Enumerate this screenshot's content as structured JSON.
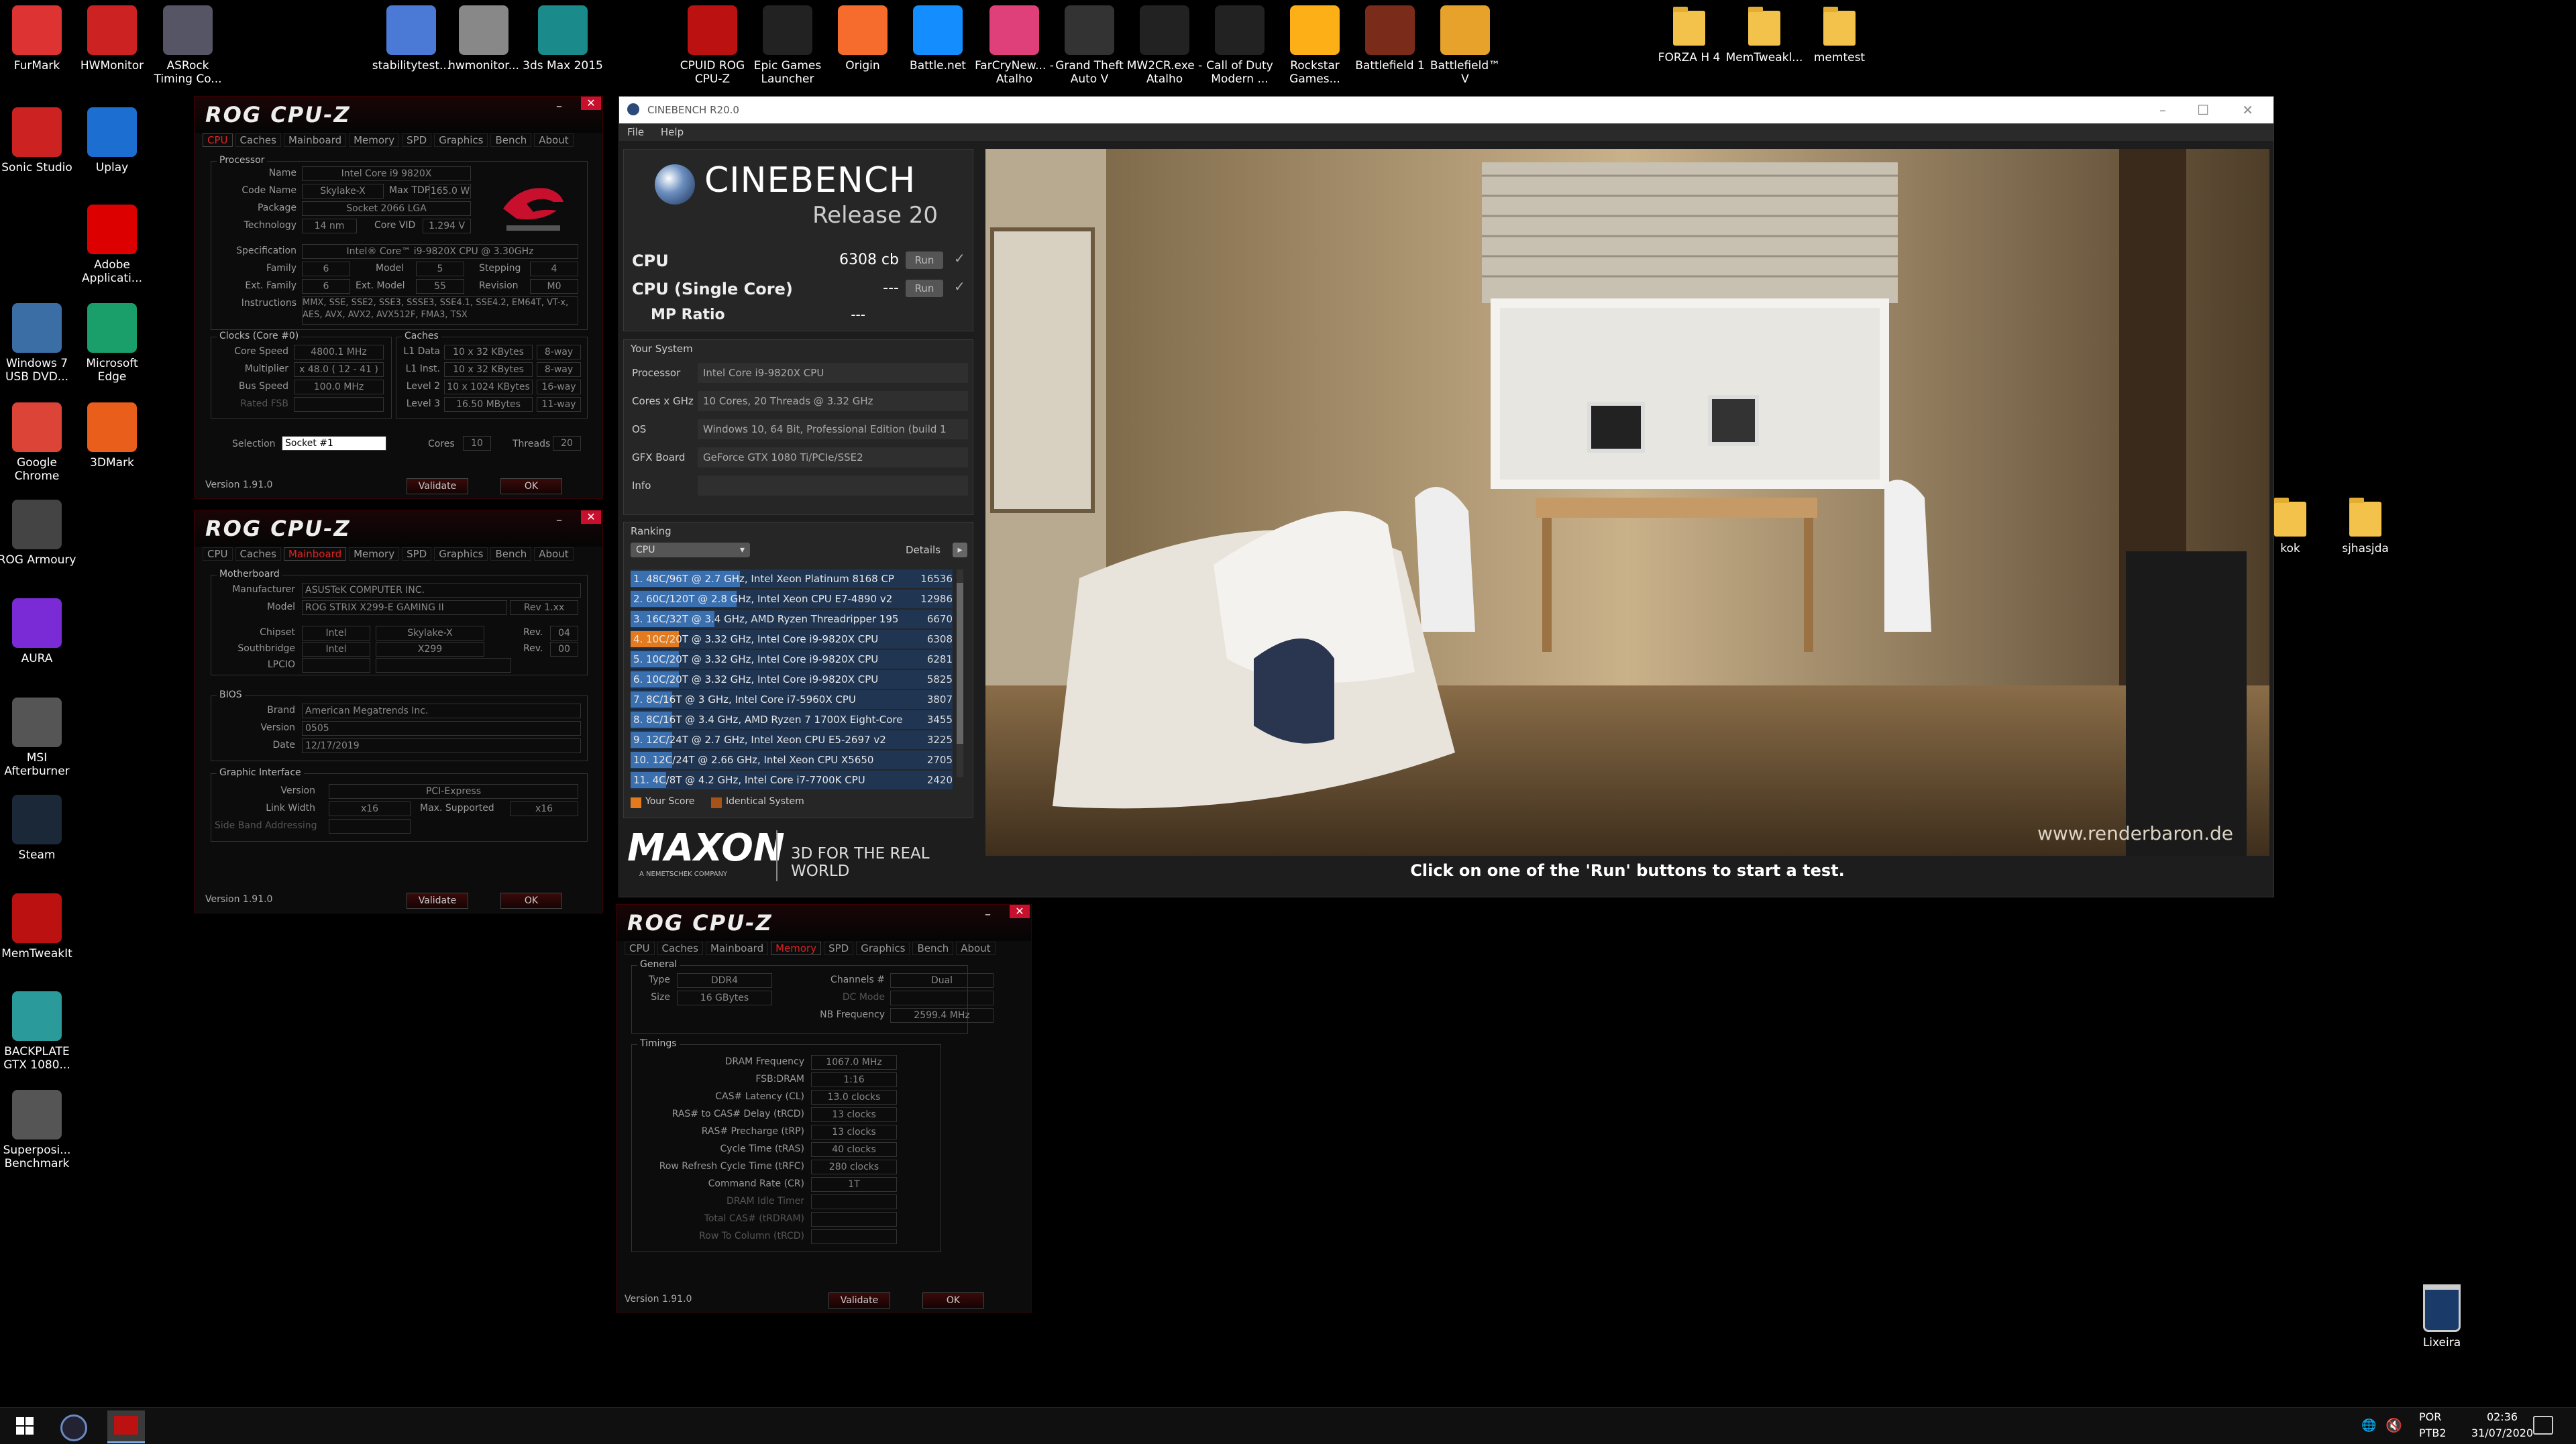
{
  "desktop": {
    "top_icons": [
      {
        "label": "FurMark",
        "color": "#d33"
      },
      {
        "label": "HWMonitor",
        "color": "#c22"
      },
      {
        "label": "ASRock Timing Co...",
        "color": "#556"
      },
      {
        "label": "stabilitytest...",
        "color": "#4a7ad6"
      },
      {
        "label": "hwmonitor...",
        "color": "#888"
      },
      {
        "label": "3ds Max 2015",
        "color": "#1a8a8a"
      },
      {
        "label": "CPUID ROG CPU-Z",
        "color": "#b11"
      },
      {
        "label": "Epic Games Launcher",
        "color": "#222"
      },
      {
        "label": "Origin",
        "color": "#f56c2d"
      },
      {
        "label": "Battle.net",
        "color": "#148eff"
      },
      {
        "label": "FarCryNew... - Atalho",
        "color": "#e0407a"
      },
      {
        "label": "Grand Theft Auto V",
        "color": "#333"
      },
      {
        "label": "MW2CR.exe - Atalho",
        "color": "#222"
      },
      {
        "label": "Call of Duty Modern ...",
        "color": "#222"
      },
      {
        "label": "Rockstar Games...",
        "color": "#fcaf17"
      },
      {
        "label": "Battlefield 1",
        "color": "#7a2b1a"
      },
      {
        "label": "Battlefield™ V",
        "color": "#e7a22c"
      }
    ],
    "folders_top": [
      "FORZA H 4",
      "MemTweakl...",
      "memtest"
    ],
    "left_icons": [
      {
        "label": "Sonic Studio",
        "color": "#c22"
      },
      {
        "label": "Uplay",
        "color": "#1c6fd1"
      },
      {
        "label": "Adobe Applicati...",
        "color": "#d00"
      },
      {
        "label": "Windows 7 USB DVD...",
        "color": "#3a6ea5"
      },
      {
        "label": "Microsoft Edge",
        "color": "#1a9e6a"
      },
      {
        "label": "Google Chrome",
        "color": "#db4437"
      },
      {
        "label": "3DMark",
        "color": "#e85e1a"
      },
      {
        "label": "ROG Armoury",
        "color": "#444"
      },
      {
        "label": "AURA",
        "color": "#7a2bd6"
      },
      {
        "label": "MSI Afterburner",
        "color": "#555"
      },
      {
        "label": "Steam",
        "color": "#1b2838"
      },
      {
        "label": "MemTweakIt",
        "color": "#b11"
      },
      {
        "label": "BACKPLATE GTX 1080...",
        "color": "#2a9a9a"
      },
      {
        "label": "Superposi... Benchmark",
        "color": "#555"
      }
    ],
    "right_folders": [
      "kok",
      "sjhasjda"
    ],
    "recycle_bin": "Lixeira"
  },
  "cpuz1": {
    "tabs": [
      "CPU",
      "Caches",
      "Mainboard",
      "Memory",
      "SPD",
      "Graphics",
      "Bench",
      "About"
    ],
    "processor_title": "Processor",
    "name_label": "Name",
    "name": "Intel Core i9 9820X",
    "codename_label": "Code Name",
    "codename": "Skylake-X",
    "maxtdp_label": "Max TDP",
    "maxtdp": "165.0 W",
    "package_label": "Package",
    "package": "Socket 2066 LGA",
    "technology_label": "Technology",
    "technology": "14 nm",
    "corevid_label": "Core VID",
    "corevid": "1.294 V",
    "spec_label": "Specification",
    "spec": "Intel® Core™ i9-9820X CPU @ 3.30GHz",
    "family_label": "Family",
    "family": "6",
    "model_label": "Model",
    "model": "5",
    "stepping_label": "Stepping",
    "stepping": "4",
    "extfamily_label": "Ext. Family",
    "extfamily": "6",
    "extmodel_label": "Ext. Model",
    "extmodel": "55",
    "revision_label": "Revision",
    "revision": "M0",
    "instructions_label": "Instructions",
    "instructions": "MMX, SSE, SSE2, SSE3, SSSE3, SSE4.1, SSE4.2, EM64T, VT-x, AES, AVX, AVX2, AVX512F, FMA3, TSX",
    "clocks_title": "Clocks (Core #0)",
    "corespeed_label": "Core Speed",
    "corespeed": "4800.1 MHz",
    "multiplier_label": "Multiplier",
    "multiplier": "x 48.0 ( 12 - 41 )",
    "busspeed_label": "Bus Speed",
    "busspeed": "100.0 MHz",
    "ratedfsb_label": "Rated FSB",
    "caches_title": "Caches",
    "l1d_label": "L1 Data",
    "l1d": "10 x 32 KBytes",
    "l1d_way": "8-way",
    "l1i_label": "L1 Inst.",
    "l1i": "10 x 32 KBytes",
    "l1i_way": "8-way",
    "l2_label": "Level 2",
    "l2": "10 x 1024 KBytes",
    "l2_way": "16-way",
    "l3_label": "Level 3",
    "l3": "16.50 MBytes",
    "l3_way": "11-way",
    "selection_label": "Selection",
    "selection": "Socket #1",
    "cores_label": "Cores",
    "cores": "10",
    "threads_label": "Threads",
    "threads": "20",
    "version": "Version 1.91.0",
    "validate": "Validate",
    "ok": "OK"
  },
  "cpuz2": {
    "tabs": [
      "CPU",
      "Caches",
      "Mainboard",
      "Memory",
      "SPD",
      "Graphics",
      "Bench",
      "About"
    ],
    "motherboard_title": "Motherboard",
    "manufacturer_label": "Manufacturer",
    "manufacturer": "ASUSTeK COMPUTER INC.",
    "model_label": "Model",
    "model": "ROG STRIX X299-E GAMING II",
    "model_rev": "Rev 1.xx",
    "chipset_label": "Chipset",
    "chipset_vendor": "Intel",
    "chipset": "Skylake-X",
    "chipset_rev_label": "Rev.",
    "chipset_rev": "04",
    "southbridge_label": "Southbridge",
    "sb_vendor": "Intel",
    "sb": "X299",
    "sb_rev_label": "Rev.",
    "sb_rev": "00",
    "lpcio_label": "LPCIO",
    "bios_title": "BIOS",
    "brand_label": "Brand",
    "brand": "American Megatrends Inc.",
    "bversion_label": "Version",
    "bversion": "0505",
    "date_label": "Date",
    "date": "12/17/2019",
    "gi_title": "Graphic Interface",
    "giversion_label": "Version",
    "giversion": "PCI-Express",
    "linkwidth_label": "Link Width",
    "linkwidth": "x16",
    "maxsup_label": "Max. Supported",
    "maxsup": "x16",
    "sideband_label": "Side Band Addressing",
    "version": "Version 1.91.0",
    "validate": "Validate",
    "ok": "OK"
  },
  "cpuz3": {
    "tabs": [
      "CPU",
      "Caches",
      "Mainboard",
      "Memory",
      "SPD",
      "Graphics",
      "Bench",
      "About"
    ],
    "general_title": "General",
    "type_label": "Type",
    "type": "DDR4",
    "channels_label": "Channels #",
    "channels": "Dual",
    "size_label": "Size",
    "size": "16 GBytes",
    "dcmode_label": "DC Mode",
    "nbfreq_label": "NB Frequency",
    "nbfreq": "2599.4 MHz",
    "timings_title": "Timings",
    "timings": [
      {
        "label": "DRAM Frequency",
        "value": "1067.0 MHz",
        "dim": false
      },
      {
        "label": "FSB:DRAM",
        "value": "1:16",
        "dim": false
      },
      {
        "label": "CAS# Latency (CL)",
        "value": "13.0 clocks",
        "dim": false
      },
      {
        "label": "RAS# to CAS# Delay (tRCD)",
        "value": "13 clocks",
        "dim": false
      },
      {
        "label": "RAS# Precharge (tRP)",
        "value": "13 clocks",
        "dim": false
      },
      {
        "label": "Cycle Time (tRAS)",
        "value": "40 clocks",
        "dim": false
      },
      {
        "label": "Row Refresh Cycle Time (tRFC)",
        "value": "280 clocks",
        "dim": false
      },
      {
        "label": "Command Rate (CR)",
        "value": "1T",
        "dim": false
      },
      {
        "label": "DRAM Idle Timer",
        "value": "",
        "dim": true
      },
      {
        "label": "Total CAS# (tRDRAM)",
        "value": "",
        "dim": true
      },
      {
        "label": "Row To Column (tRCD)",
        "value": "",
        "dim": true
      }
    ],
    "version": "Version 1.91.0",
    "validate": "Validate",
    "ok": "OK"
  },
  "cinebench": {
    "window_title": "CINEBENCH R20.0",
    "menu": [
      "File",
      "Help"
    ],
    "logo_title": "CINEBENCH",
    "logo_sub": "Release 20",
    "cpu_label": "CPU",
    "cpu_score": "6308 cb",
    "single_label": "CPU (Single Core)",
    "single_score": "---",
    "mp_label": "MP Ratio",
    "mp_score": "---",
    "run": "Run",
    "your_system": "Your System",
    "system": [
      {
        "label": "Processor",
        "value": "Intel Core i9-9820X CPU"
      },
      {
        "label": "Cores x GHz",
        "value": "10 Cores, 20 Threads @ 3.32 GHz"
      },
      {
        "label": "OS",
        "value": "Windows 10, 64 Bit, Professional Edition (build 1"
      },
      {
        "label": "GFX Board",
        "value": "GeForce GTX 1080 Ti/PCIe/SSE2"
      },
      {
        "label": "Info",
        "value": ""
      }
    ],
    "ranking_title": "Ranking",
    "ranking_select": "CPU",
    "details": "Details",
    "ranking": [
      {
        "text": "1. 48C/96T @ 2.7 GHz, Intel Xeon Platinum 8168 CP",
        "score": "16536",
        "fill": 0.34,
        "mine": false
      },
      {
        "text": "2. 60C/120T @ 2.8 GHz, Intel Xeon CPU E7-4890 v2",
        "score": "12986",
        "fill": 0.33,
        "mine": false
      },
      {
        "text": "3. 16C/32T @ 3.4 GHz, AMD Ryzen Threadripper 195",
        "score": "6670",
        "fill": 0.26,
        "mine": false
      },
      {
        "text": "4. 10C/20T @ 3.32 GHz, Intel Core i9-9820X CPU",
        "score": "6308",
        "fill": 0.15,
        "mine": true
      },
      {
        "text": "5. 10C/20T @ 3.32 GHz, Intel Core i9-9820X CPU",
        "score": "6281",
        "fill": 0.15,
        "mine": false
      },
      {
        "text": "6. 10C/20T @ 3.32 GHz, Intel Core i9-9820X CPU",
        "score": "5825",
        "fill": 0.15,
        "mine": false
      },
      {
        "text": "7. 8C/16T @ 3 GHz, Intel Core i7-5960X CPU",
        "score": "3807",
        "fill": 0.13,
        "mine": false
      },
      {
        "text": "8. 8C/16T @ 3.4 GHz, AMD Ryzen 7 1700X Eight-Core",
        "score": "3455",
        "fill": 0.13,
        "mine": false
      },
      {
        "text": "9. 12C/24T @ 2.7 GHz, Intel Xeon CPU E5-2697 v2",
        "score": "3225",
        "fill": 0.13,
        "mine": false
      },
      {
        "text": "10. 12C/24T @ 2.66 GHz, Intel Xeon CPU X5650",
        "score": "2705",
        "fill": 0.13,
        "mine": false
      },
      {
        "text": "11. 4C/8T @ 4.2 GHz, Intel Core i7-7700K CPU",
        "score": "2420",
        "fill": 0.11,
        "mine": false
      }
    ],
    "legend_your": "Your Score",
    "legend_identical": "Identical System",
    "maxon": "MAXON",
    "maxon_sub": "A NEMETSCHEK COMPANY",
    "tagline": "3D FOR THE REAL WORLD",
    "watermark": "www.renderbaron.de",
    "status": "Click on one of the 'Run' buttons to start a test."
  },
  "taskbar": {
    "lang1": "POR",
    "lang2": "PTB2",
    "time": "02:36",
    "date": "31/07/2020"
  }
}
